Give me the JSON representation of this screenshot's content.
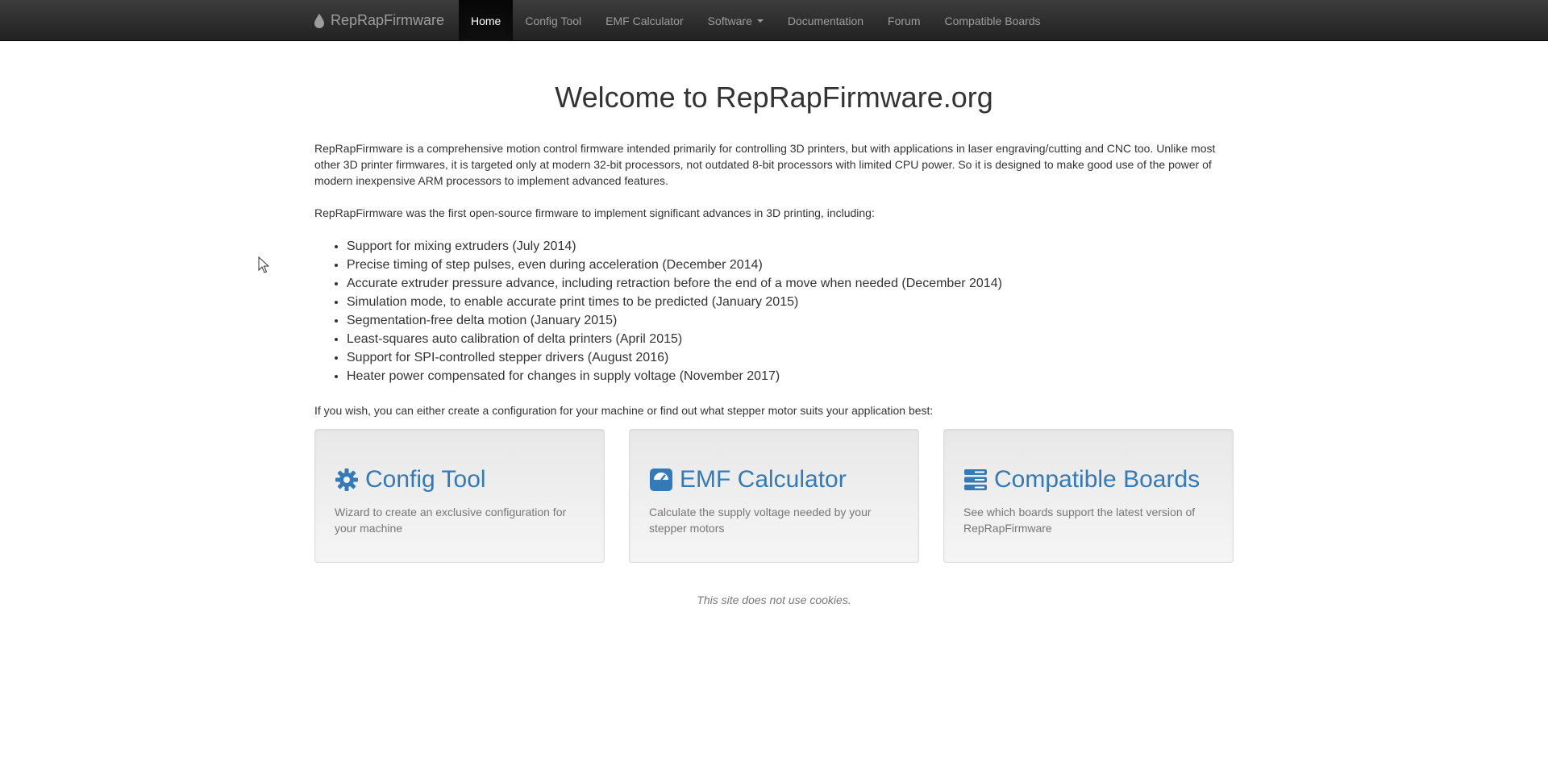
{
  "navbar": {
    "brand": "RepRapFirmware",
    "brand_icon": "drop-icon",
    "items": [
      {
        "label": "Home",
        "active": true
      },
      {
        "label": "Config Tool"
      },
      {
        "label": "EMF Calculator"
      },
      {
        "label": "Software",
        "dropdown": true
      },
      {
        "label": "Documentation"
      },
      {
        "label": "Forum"
      },
      {
        "label": "Compatible Boards"
      }
    ]
  },
  "main": {
    "title": "Welcome to RepRapFirmware.org",
    "intro": "RepRapFirmware is a comprehensive motion control firmware intended primarily for controlling 3D printers, but with applications in laser engraving/cutting and CNC too. Unlike most other 3D printer firmwares, it is targeted only at modern 32-bit processors, not outdated 8-bit processors with limited CPU power. So it is designed to make good use of the power of modern inexpensive ARM processors to implement advanced features.",
    "features_intro": "RepRapFirmware was the first open-source firmware to implement significant advances in 3D printing, including:",
    "features": [
      "Support for mixing extruders (July 2014)",
      "Precise timing of step pulses, even during acceleration (December 2014)",
      "Accurate extruder pressure advance, including retraction before the end of a move when needed (December 2014)",
      "Simulation mode, to enable accurate print times to be predicted (January 2015)",
      "Segmentation-free delta motion (January 2015)",
      "Least-squares auto calibration of delta printers (April 2015)",
      "Support for SPI-controlled stepper drivers (August 2016)",
      "Heater power compensated for changes in supply voltage (November 2017)"
    ],
    "cta": "If you wish, you can either create a configuration for your machine or find out what stepper motor suits your application best:",
    "cards": [
      {
        "icon": "gear-icon",
        "title": "Config Tool",
        "description": "Wizard to create an exclusive configuration for your machine"
      },
      {
        "icon": "dashboard-icon",
        "title": "EMF Calculator",
        "description": "Calculate the supply voltage needed by your stepper motors"
      },
      {
        "icon": "server-icon",
        "title": "Compatible Boards",
        "description": "See which boards support the latest version of RepRapFirmware"
      }
    ],
    "footer_note": "This site does not use cookies."
  },
  "colors": {
    "link": "#337ab7",
    "navbar_bg": "#222222",
    "muted": "#777777"
  }
}
